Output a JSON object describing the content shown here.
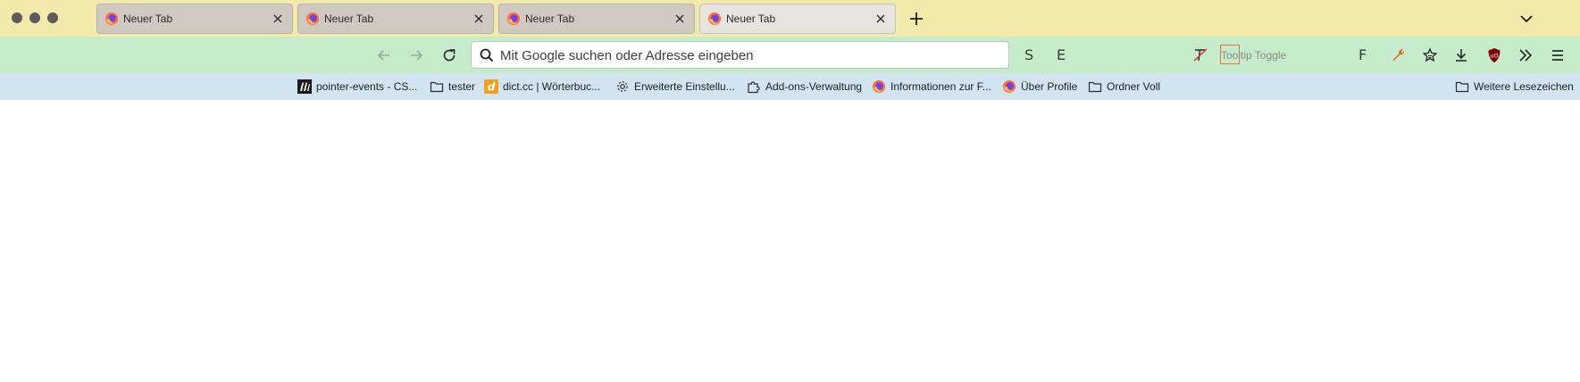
{
  "tabs": [
    {
      "title": "Neuer Tab",
      "active": false
    },
    {
      "title": "Neuer Tab",
      "active": false
    },
    {
      "title": "Neuer Tab",
      "active": false
    },
    {
      "title": "Neuer Tab",
      "active": true
    }
  ],
  "navbar": {
    "url_placeholder": "Mit Google suchen oder Adresse eingeben",
    "ext_s": "S",
    "ext_e": "E",
    "tooltip_toggle": "Tooltip Toggle",
    "ext_f": "F"
  },
  "bookmarks": [
    {
      "label": "pointer-events - CS...",
      "icon": "mdn-icon"
    },
    {
      "label": "tester",
      "icon": "folder-icon"
    },
    {
      "label": "dict.cc | Wörterbuc...",
      "icon": "dictcc-icon"
    },
    {
      "label": "Erweiterte Einstellu...",
      "icon": "gear-icon"
    },
    {
      "label": "Add-ons-Verwaltung",
      "icon": "puzzle-icon"
    },
    {
      "label": "Informationen zur F...",
      "icon": "firefox-icon"
    },
    {
      "label": "Über Profile",
      "icon": "firefox-icon"
    },
    {
      "label": "Ordner Voll",
      "icon": "folder-icon"
    }
  ],
  "other_bookmarks": {
    "label": "Weitere Lesezeichen",
    "icon": "folder-icon"
  },
  "colors": {
    "tabstrip": "#f2eaab",
    "navbar": "#c6eccb",
    "bookmarks_bar": "#d1e4ef",
    "ublock": "#800000",
    "tools_icon": "#d86a1f"
  }
}
